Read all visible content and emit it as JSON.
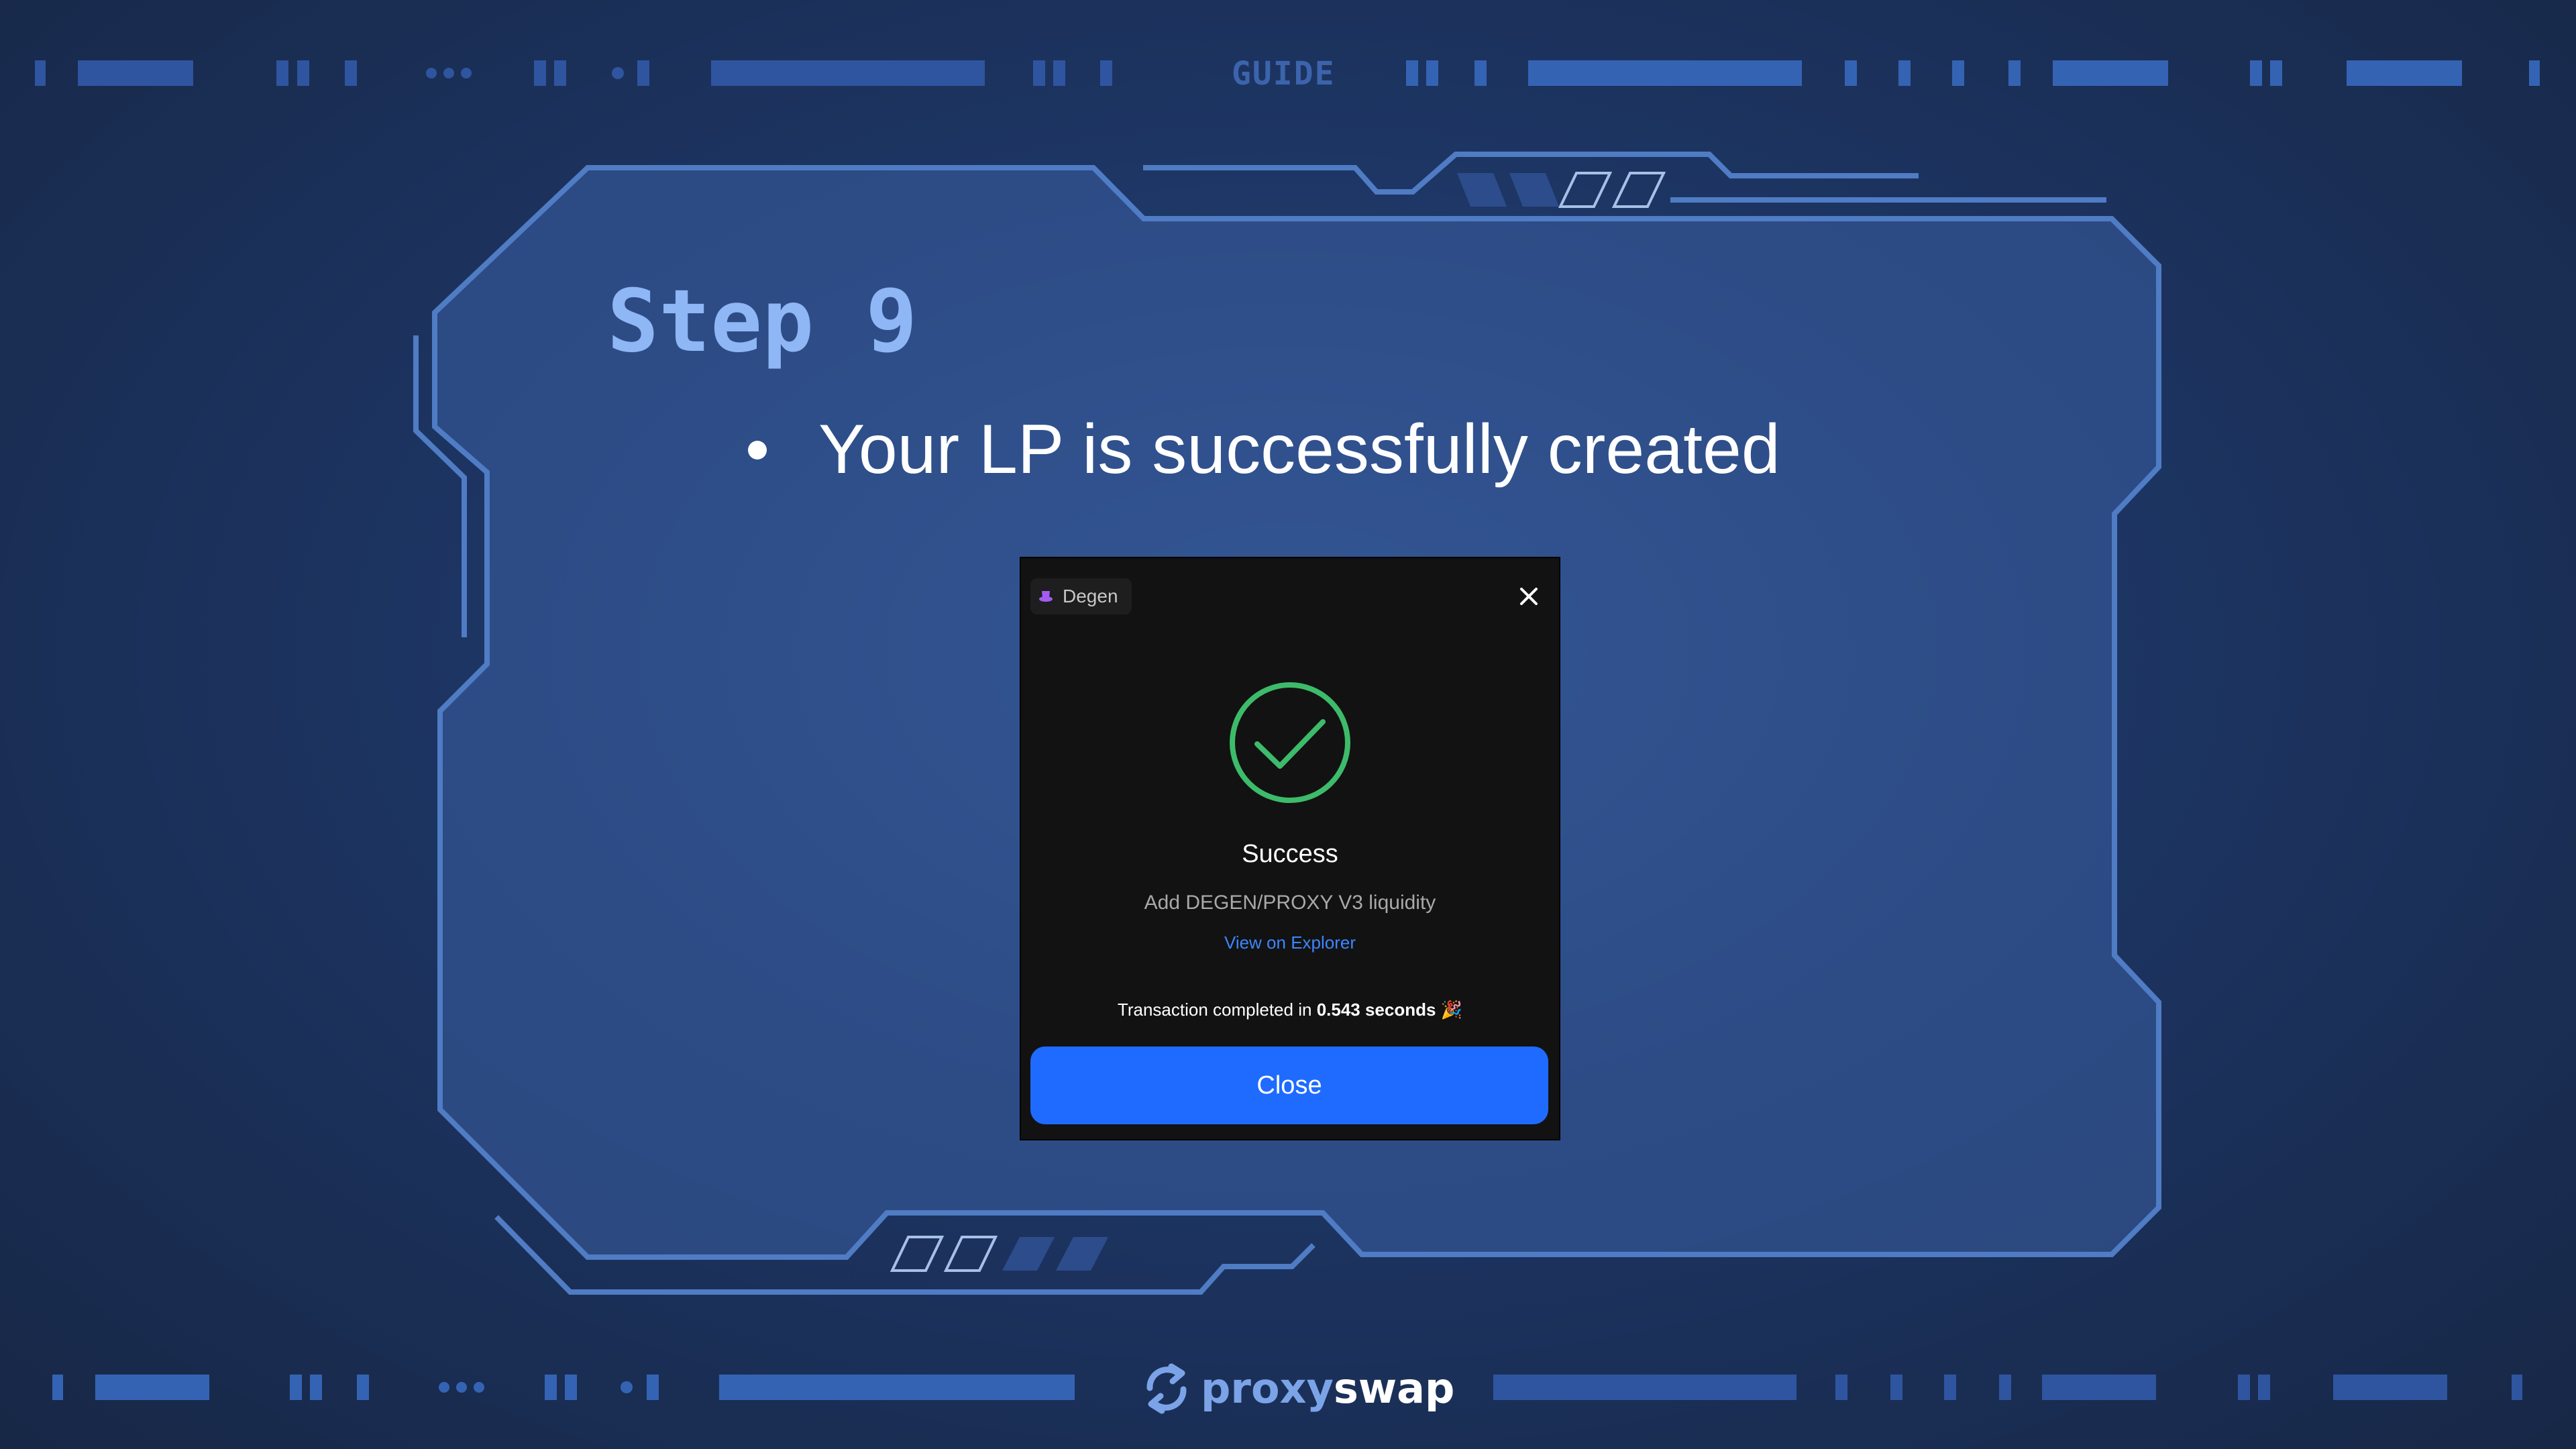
{
  "header": {
    "label": "GUIDE"
  },
  "slide": {
    "title": "Step 9",
    "bullet": "Your LP is successfully created"
  },
  "modal": {
    "chain_badge": "Degen",
    "chain_icon": "hat-icon",
    "close_icon": "close-icon",
    "status_icon": "check-circle-icon",
    "status_title": "Success",
    "description": "Add DEGEN/PROXY V3 liquidity",
    "explorer_link": "View on Explorer",
    "tx_prefix": "Transaction completed in",
    "tx_time": "0.543 seconds",
    "tx_emoji": "🎉",
    "close_button": "Close"
  },
  "footer": {
    "brand_part1": "proxy",
    "brand_part2": "swap"
  },
  "colors": {
    "background": "#1d3563",
    "accent_blue": "#1f6bff",
    "success_green": "#3dbb6b",
    "title_blue": "#8fb6f5",
    "frame_stroke": "#4f7cc4"
  }
}
